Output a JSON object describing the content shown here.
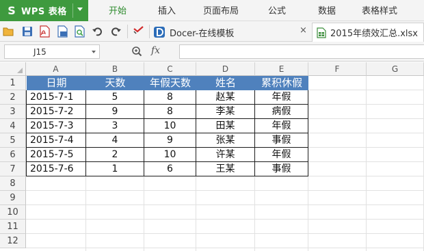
{
  "app": {
    "title": "WPS 表格",
    "logo": "S"
  },
  "menu": {
    "tabs": [
      "开始",
      "插入",
      "页面布局",
      "公式",
      "数据",
      "表格样式"
    ],
    "active_tab": "开始"
  },
  "toolbar": {
    "icons": [
      "open-icon",
      "save-icon",
      "export-pdf-icon",
      "print-icon",
      "print-preview-icon",
      "undo-icon",
      "redo-icon",
      "format-painter-icon"
    ],
    "docer_tab": "Docer-在线模板",
    "file_tab": "2015年绩效汇总.xlsx",
    "close_glyph": "×",
    "active_color": "#2e8b2e"
  },
  "formula_bar": {
    "name_box": "J15",
    "fx_label": "fx",
    "formula": ""
  },
  "grid": {
    "columns": [
      "A",
      "B",
      "C",
      "D",
      "E",
      "F",
      "G"
    ],
    "rows": [
      "1",
      "2",
      "3",
      "4",
      "5",
      "6",
      "7",
      "8",
      "9",
      "10",
      "11",
      "12"
    ],
    "header_fill": "#4f81bd",
    "table": {
      "headers": [
        "日期",
        "天数",
        "年假天数",
        "姓名",
        "累积休假"
      ],
      "rows": [
        [
          "2015-7-1",
          "5",
          "8",
          "赵某",
          "年假"
        ],
        [
          "2015-7-2",
          "9",
          "8",
          "李某",
          "病假"
        ],
        [
          "2015-7-3",
          "3",
          "10",
          "田某",
          "年假"
        ],
        [
          "2015-7-4",
          "4",
          "9",
          "张某",
          "事假"
        ],
        [
          "2015-7-5",
          "2",
          "10",
          "许某",
          "年假"
        ],
        [
          "2015-7-6",
          "1",
          "6",
          "王某",
          "事假"
        ]
      ]
    }
  }
}
